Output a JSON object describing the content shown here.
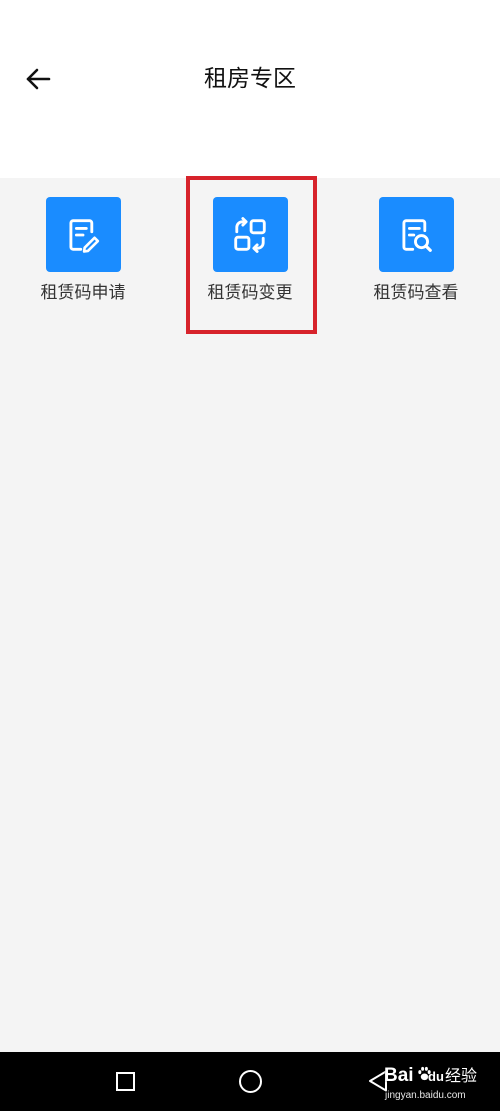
{
  "header": {
    "title": "租房专区",
    "back_icon": "arrow-left-icon"
  },
  "services": [
    {
      "label": "租赁码申请",
      "icon": "document-edit-icon",
      "highlighted": false
    },
    {
      "label": "租赁码变更",
      "icon": "swap-change-icon",
      "highlighted": true
    },
    {
      "label": "租赁码查看",
      "icon": "document-search-icon",
      "highlighted": false
    }
  ],
  "nav": {
    "recent_icon": "square-icon",
    "home_icon": "circle-icon",
    "back_icon": "triangle-back-icon"
  },
  "watermark": {
    "brand_left": "Bai",
    "brand_right": "du",
    "product": "经验",
    "url": "jingyan.baidu.com",
    "logo_icon": "paw-icon"
  },
  "colors": {
    "tile": "#1a8cff",
    "highlight": "#d7232b",
    "background": "#f4f4f4",
    "navbar": "#000000"
  }
}
